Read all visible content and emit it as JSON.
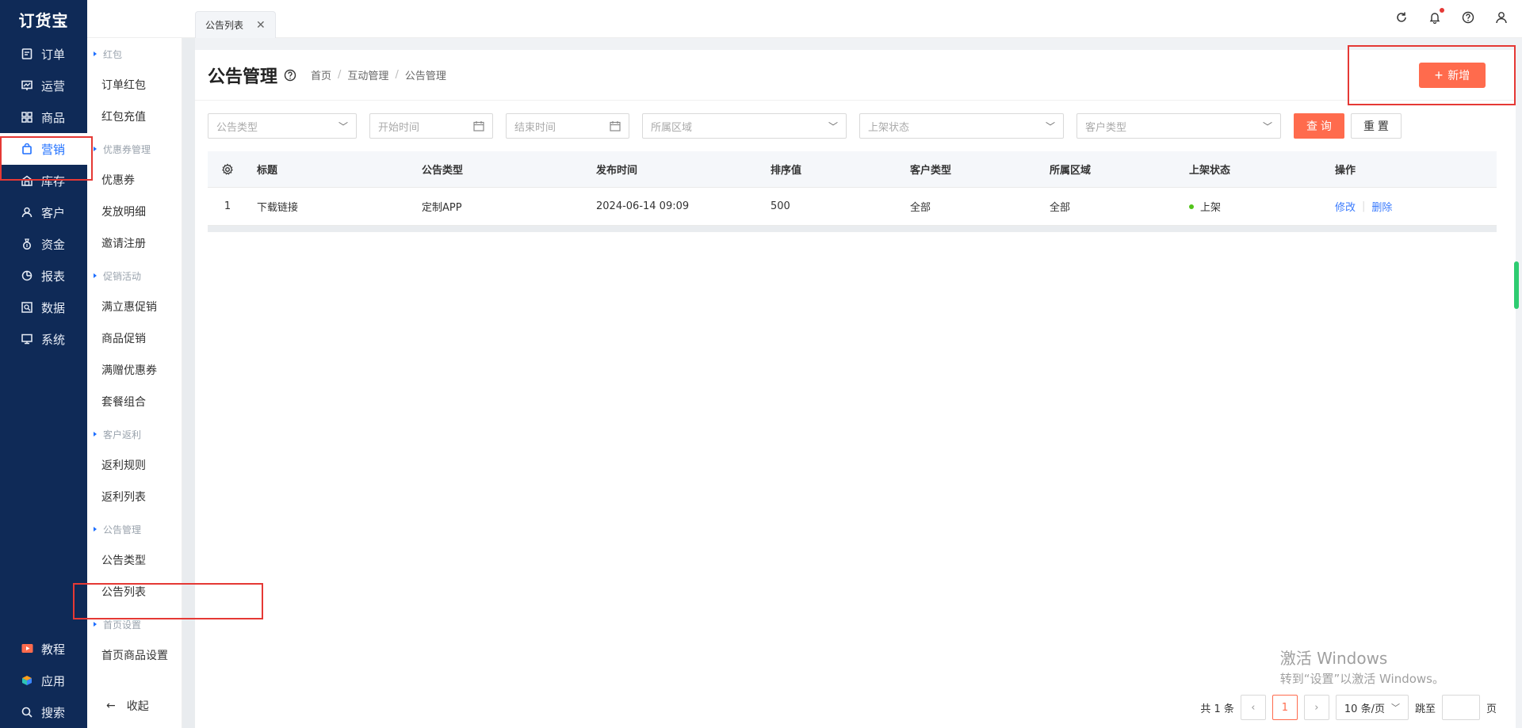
{
  "app": {
    "logo": "订货宝"
  },
  "nav": {
    "items": [
      {
        "label": "订单",
        "icon": "document-icon"
      },
      {
        "label": "运营",
        "icon": "chart-board-icon"
      },
      {
        "label": "商品",
        "icon": "grid-icon"
      },
      {
        "label": "营销",
        "icon": "bag-icon"
      },
      {
        "label": "库存",
        "icon": "warehouse-icon"
      },
      {
        "label": "客户",
        "icon": "user-icon"
      },
      {
        "label": "资金",
        "icon": "money-bag-icon"
      },
      {
        "label": "报表",
        "icon": "pie-icon"
      },
      {
        "label": "数据",
        "icon": "data-icon"
      },
      {
        "label": "系统",
        "icon": "monitor-icon"
      }
    ],
    "bottom": [
      {
        "label": "教程",
        "icon": "video-icon"
      },
      {
        "label": "应用",
        "icon": "cube-icon"
      },
      {
        "label": "搜索",
        "icon": "search-icon"
      }
    ]
  },
  "subnav": {
    "groups": [
      {
        "title": "红包",
        "items": [
          "订单红包",
          "红包充值"
        ]
      },
      {
        "title": "优惠券管理",
        "items": [
          "优惠券",
          "发放明细",
          "邀请注册"
        ]
      },
      {
        "title": "促销活动",
        "items": [
          "满立惠促销",
          "商品促销",
          "满赠优惠券",
          "套餐组合"
        ]
      },
      {
        "title": "客户返利",
        "items": [
          "返利规则",
          "返利列表"
        ]
      },
      {
        "title": "公告管理",
        "items": [
          "公告类型",
          "公告列表"
        ]
      },
      {
        "title": "首页设置",
        "items": [
          "首页商品设置"
        ]
      }
    ],
    "collapse_label": "收起"
  },
  "tab": {
    "label": "公告列表"
  },
  "page": {
    "title": "公告管理",
    "breadcrumb": [
      "首页",
      "互动管理",
      "公告管理"
    ],
    "add_button": "新增"
  },
  "filters": {
    "type_placeholder": "公告类型",
    "start_placeholder": "开始时间",
    "end_placeholder": "结束时间",
    "region_placeholder": "所属区域",
    "status_placeholder": "上架状态",
    "customer_placeholder": "客户类型",
    "query_label": "查 询",
    "reset_label": "重 置"
  },
  "table": {
    "headers": [
      "标题",
      "公告类型",
      "发布时间",
      "排序值",
      "客户类型",
      "所属区域",
      "上架状态",
      "操作"
    ],
    "rows": [
      {
        "index": "1",
        "title": "下载链接",
        "type": "定制APP",
        "time": "2024-06-14 09:09",
        "sort": "500",
        "customer": "全部",
        "region": "全部",
        "status": "上架",
        "edit": "修改",
        "delete": "删除"
      }
    ]
  },
  "pager": {
    "total": "共 1 条",
    "current": "1",
    "size": "10 条/页",
    "jump_prefix": "跳至",
    "jump_suffix": "页"
  },
  "watermark": {
    "line1": "激活 Windows",
    "line2": "转到“设置”以激活 Windows。"
  },
  "colors": {
    "nav_bg": "#0f2a57",
    "accent": "#ff6b4d",
    "link": "#3b7bfd",
    "active_nav": "#1e6fff",
    "status_on": "#52c41a",
    "highlight": "#e53935"
  }
}
